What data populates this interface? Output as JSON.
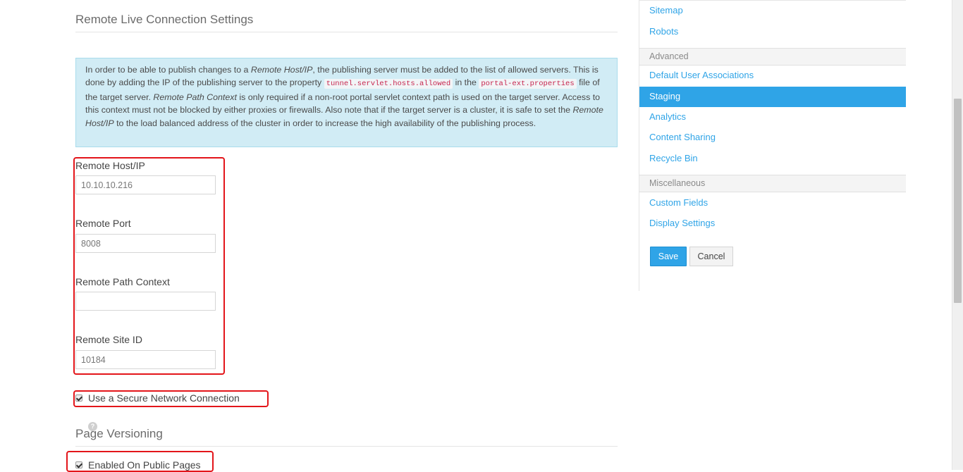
{
  "main": {
    "section_title": "Remote Live Connection Settings",
    "info": {
      "p1": "In order to be able to publish changes to a ",
      "em1": "Remote Host/IP",
      "p2": ", the publishing server must be added to the list of allowed servers. This is done by adding the IP of the publishing server to the property ",
      "code1": "tunnel.servlet.hosts.allowed",
      "p3": " in the ",
      "code2": "portal-ext.properties",
      "p4": " file of the target server. ",
      "em2": "Remote Path Context",
      "p5": " is only required if a non-root portal servlet context path is used on the target server. Access to this context must not be blocked by either proxies or firewalls. Also note that if the target server is a cluster, it is safe to set the ",
      "em3": "Remote Host/IP",
      "p6": " to the load balanced address of the cluster in order to increase the high availability of the publishing process."
    },
    "fields": {
      "host_label": "Remote Host/IP",
      "host_value": "10.10.10.216",
      "port_label": "Remote Port",
      "port_value": "8008",
      "path_label": "Remote Path Context",
      "path_value": "",
      "site_label": "Remote Site ID",
      "site_value": "10184"
    },
    "secure_label": "Use a Secure Network Connection",
    "page_versioning_title": "Page Versioning",
    "public_pages_label": "Enabled On Public Pages"
  },
  "sidebar": {
    "sitemap": "Sitemap",
    "robots": "Robots",
    "advanced_header": "Advanced",
    "default_user_assoc": "Default User Associations",
    "staging": "Staging",
    "analytics": "Analytics",
    "content_sharing": "Content Sharing",
    "recycle_bin": "Recycle Bin",
    "misc_header": "Miscellaneous",
    "custom_fields": "Custom Fields",
    "display_settings": "Display Settings",
    "save": "Save",
    "cancel": "Cancel"
  },
  "colors": {
    "accent": "#2fa4e7",
    "info_bg": "#d1ecf5",
    "highlight_red": "#e3151a"
  }
}
